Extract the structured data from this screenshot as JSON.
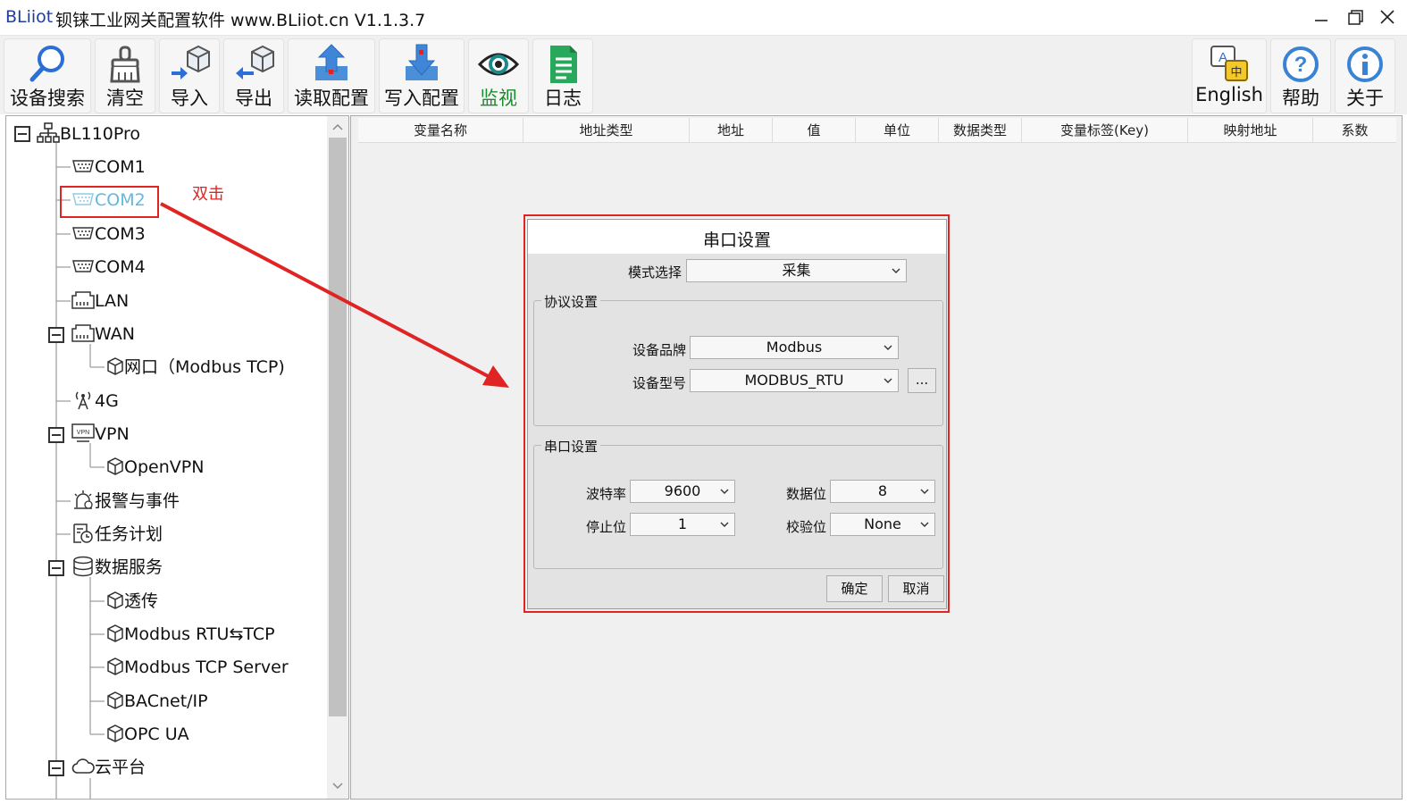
{
  "window": {
    "brand": "BLiiot",
    "title": "钡铼工业网关配置软件 www.BLiiot.cn V1.1.3.7"
  },
  "toolbar": {
    "search": "设备搜索",
    "clear": "清空",
    "import": "导入",
    "export": "导出",
    "read_config": "读取配置",
    "write_config": "写入配置",
    "monitor": "监视",
    "log": "日志",
    "english": "English",
    "help": "帮助",
    "about": "关于"
  },
  "tree": {
    "root": "BL110Pro",
    "com1": "COM1",
    "com2": "COM2",
    "com3": "COM3",
    "com4": "COM4",
    "lan": "LAN",
    "wan": "WAN",
    "wan_port": "网口（Modbus TCP)",
    "g4": "4G",
    "vpn": "VPN",
    "openvpn": "OpenVPN",
    "alarm": "报警与事件",
    "task": "任务计划",
    "data_service": "数据服务",
    "passthrough": "透传",
    "modbus_rtu_tcp": "Modbus RTU⇆TCP",
    "modbus_tcp_server": "Modbus TCP Server",
    "bacnet": "BACnet/IP",
    "opcua": "OPC UA",
    "cloud": "云平台"
  },
  "annotation": {
    "text": "双击",
    "color": "#e02424"
  },
  "variables": {
    "columns": [
      "变量名称",
      "地址类型",
      "地址",
      "值",
      "单位",
      "数据类型",
      "变量标签(Key)",
      "映射地址",
      "系数"
    ]
  },
  "dialog": {
    "title": "串口设置",
    "mode_label": "模式选择",
    "mode_value": "采集",
    "protocol_group": "协议设置",
    "brand_label": "设备品牌",
    "brand_value": "Modbus",
    "model_label": "设备型号",
    "model_value": "MODBUS_RTU",
    "more_button": "...",
    "serial_group": "串口设置",
    "baud_label": "波特率",
    "baud_value": "9600",
    "databits_label": "数据位",
    "databits_value": "8",
    "stopbits_label": "停止位",
    "stopbits_value": "1",
    "parity_label": "校验位",
    "parity_value": "None",
    "ok": "确定",
    "cancel": "取消"
  },
  "colors": {
    "accent_blue": "#4a8fd8",
    "selected_text": "#63b8e0",
    "monitor_green": "#1c8c2e",
    "log_green": "#27a85a",
    "annotation_red": "#e02424"
  }
}
